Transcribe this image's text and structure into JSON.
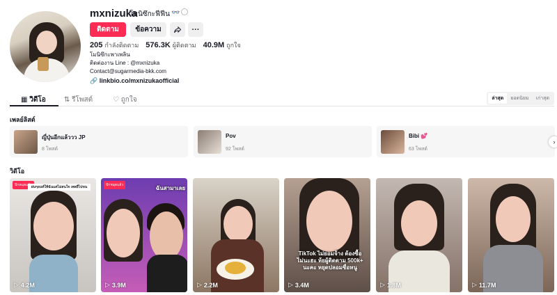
{
  "profile": {
    "username": "mxnizuka",
    "nickname": "โมนิซึกะฟีฟีน",
    "nickname_emoji": "👓",
    "follow_label": "ติดตาม",
    "message_label": "ข้อความ",
    "share_icon": "share-icon",
    "more_icon": "more-icon",
    "stats": {
      "following_count": "205",
      "following_label": "กำลังติดตาม",
      "followers_count": "576.3K",
      "followers_label": "ผู้ติดตาม",
      "likes_count": "40.9M",
      "likes_label": "ถูกใจ"
    },
    "bio_lines": [
      "โมนิซึกะพาเพลิน",
      "ติดต่องาน Line : @mxnizuka",
      "Contact@sugarmedia-bkk.com"
    ],
    "link": "linkbio.co/mxnizukaofficial"
  },
  "tabs": {
    "videos": "วิดีโอ",
    "reposts": "รีโพสต์",
    "liked": "ถูกใจ"
  },
  "sort": [
    "ล่าสุด",
    "ยอดนิยม",
    "เก่าสุด"
  ],
  "playlists_title": "เพลย์ลิสต์",
  "playlists": [
    {
      "title": "ญี่ปุ่นอีกแล้ววว JP",
      "count": "8 โพสต์"
    },
    {
      "title": "Pov",
      "count": "92 โพสต์"
    },
    {
      "title": "Bibi 💕",
      "count": "63 โพสต์"
    }
  ],
  "videos_title": "วิดีโอ",
  "videos": [
    {
      "views": "4.2M",
      "tag": "ปักหมุดแล้ว",
      "caption": "ผ่นๆอนท์ให้ฉันแต่ไม่สนใจ เพลยี่ไปขน"
    },
    {
      "views": "3.9M",
      "tag": "ปักหมุดแล้ว",
      "caption": "ฉันสามาเลย"
    },
    {
      "views": "2.2M",
      "tag": "",
      "caption": ""
    },
    {
      "views": "3.4M",
      "tag": "",
      "caption": "TikTok ไม่ยอมจ้าง ต้องซื้อไม่นะฮะ ห้ยผู้ติดตาม 500k+ นะคะ หยุดปลอมชื่อหนู"
    },
    {
      "views": "1.8M",
      "tag": "",
      "caption": ""
    },
    {
      "views": "11.7M",
      "tag": "",
      "caption": ""
    }
  ],
  "colors": {
    "accent": "#fe2c55",
    "text": "#161823"
  }
}
